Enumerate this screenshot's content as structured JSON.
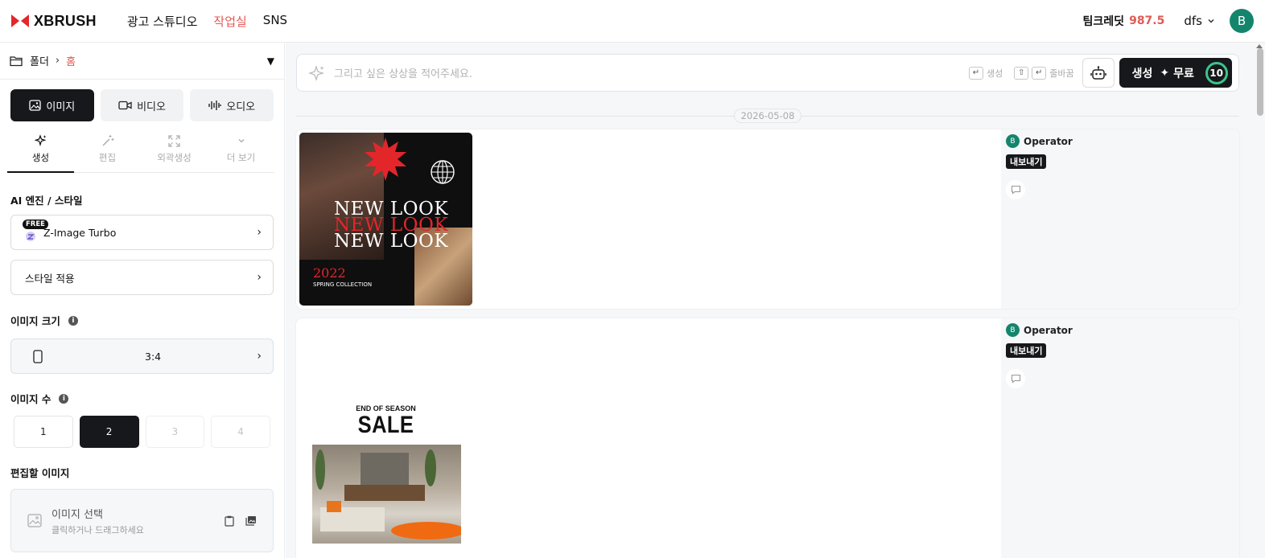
{
  "header": {
    "logo_text": "XBRUSH",
    "nav": [
      {
        "label": "광고 스튜디오",
        "active": false
      },
      {
        "label": "작업실",
        "active": true
      },
      {
        "label": "SNS",
        "active": false
      }
    ],
    "credits_label": "팀크레딧",
    "credits_value": "987.5",
    "user_name": "dfs",
    "avatar_letter": "B"
  },
  "sidebar": {
    "folder_label": "폴더",
    "folder_current": "홈",
    "media_tabs": [
      {
        "label": "이미지",
        "icon": "image-icon",
        "active": true
      },
      {
        "label": "비디오",
        "icon": "video-icon",
        "active": false
      },
      {
        "label": "오디오",
        "icon": "audio-icon",
        "active": false
      }
    ],
    "sub_tabs": [
      {
        "label": "생성",
        "icon": "sparkle-icon",
        "active": true
      },
      {
        "label": "편집",
        "icon": "magic-wand-icon",
        "active": false
      },
      {
        "label": "외곽생성",
        "icon": "expand-icon",
        "active": false
      },
      {
        "label": "더 보기",
        "icon": "chevron-down-icon",
        "active": false
      }
    ],
    "engine_section_label": "AI 엔진 / 스타일",
    "engine_badge": "FREE",
    "engine_name": "Z-Image Turbo",
    "style_label": "스타일 적용",
    "size_section_label": "이미지 크기",
    "size_value": "3:4",
    "count_section_label": "이미지 수",
    "counts": [
      {
        "label": "1",
        "state": "normal"
      },
      {
        "label": "2",
        "state": "active"
      },
      {
        "label": "3",
        "state": "disabled"
      },
      {
        "label": "4",
        "state": "disabled"
      }
    ],
    "edit_section_label": "편집할 이미지",
    "upload_title": "이미지 선택",
    "upload_hint": "클릭하거나 드래그하세요"
  },
  "main": {
    "prompt_placeholder": "그리고 싶은 상상을 적어주세요.",
    "hint_generate": "생성",
    "hint_newline": "줄바꿈",
    "generate_label": "생성",
    "free_label": "무료",
    "generate_count": "10",
    "date": "2026-05-08",
    "cards": [
      {
        "operator": "Operator",
        "operator_initial": "B",
        "export_label": "내보내기",
        "image": {
          "headline_lines": [
            "NEW LOOK",
            "NEW LOOK",
            "NEW LOOK"
          ],
          "year": "2022",
          "collection": "SPRING COLLECTION"
        }
      },
      {
        "operator": "Operator",
        "operator_initial": "B",
        "export_label": "내보내기",
        "image": {
          "small_text": "END OF SEASON",
          "big_text": "SALE"
        }
      }
    ]
  },
  "colors": {
    "accent": "#e05b55",
    "dark": "#16181b",
    "avatar": "#14856d",
    "counter_ring": "#3dc38a"
  }
}
